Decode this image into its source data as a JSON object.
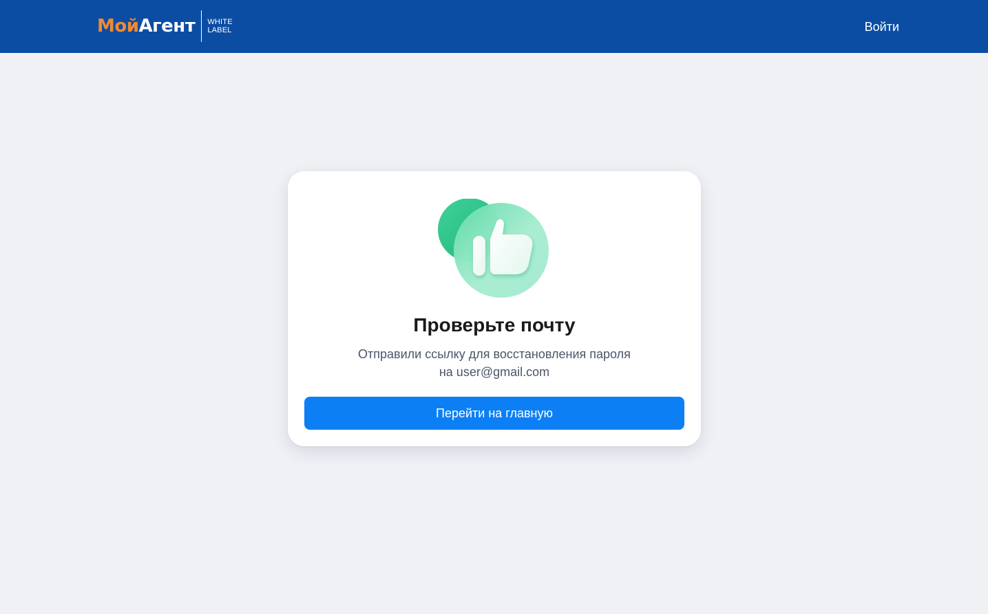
{
  "header": {
    "logo": {
      "part1": "Мой",
      "part2": "Агент",
      "tag_line1": "WHITE",
      "tag_line2": "LABEL"
    },
    "login_label": "Войти",
    "background": "#0c4da4",
    "logo_accent": "#f08a32"
  },
  "card": {
    "icon": "thumbs-up-icon",
    "title": "Проверьте почту",
    "message_line1": "Отправили ссылку для восстановления пароля",
    "message_line2": "на user@gmail.com",
    "button_label": "Перейти на главную",
    "button_color": "#0d7ff5"
  },
  "page": {
    "background": "#eff1f5"
  }
}
